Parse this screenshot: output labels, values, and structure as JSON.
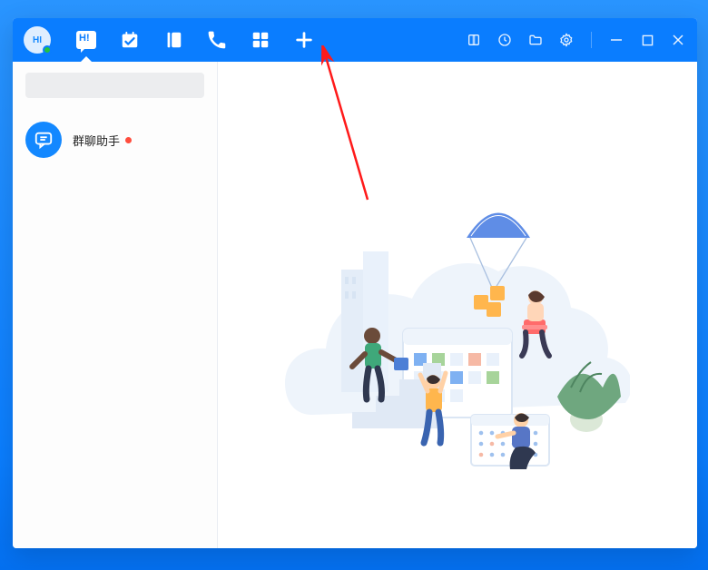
{
  "titlebar": {
    "avatar_label": "HI",
    "status": "online"
  },
  "nav": {
    "chat_label": "H!"
  },
  "sidebar": {
    "search_placeholder": "",
    "items": [
      {
        "name": "群聊助手",
        "unread": true
      }
    ]
  }
}
